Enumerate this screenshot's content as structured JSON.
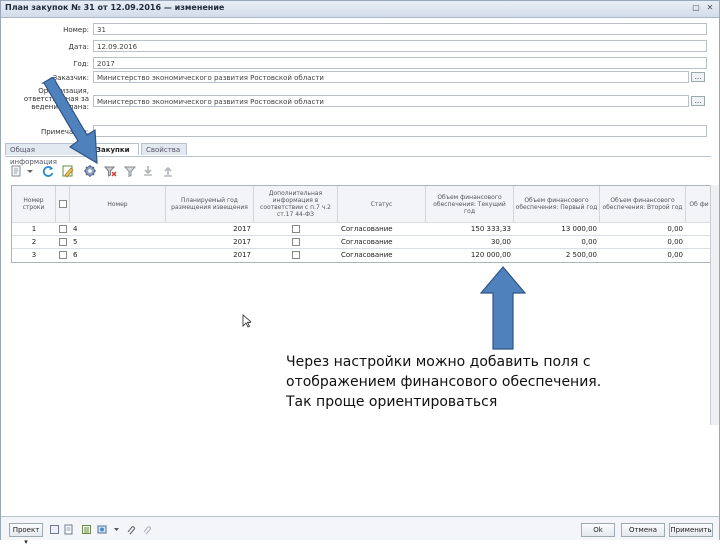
{
  "window": {
    "title": "План закупок № 31 от 12.09.2016 — изменение",
    "controls": [
      "▢",
      "✕"
    ]
  },
  "form": {
    "fields": [
      {
        "label": "Номер:",
        "value": "31"
      },
      {
        "label": "Дата:",
        "value": "12.09.2016"
      },
      {
        "label": "Год:",
        "value": "2017"
      },
      {
        "label": "Заказчик:",
        "value": "Министерство экономического развития Ростовской области"
      },
      {
        "label": "Организация, ответственная за ведение плана:",
        "value": "Министерство экономического развития Ростовской области"
      },
      {
        "label": "Примечание:",
        "value": ""
      }
    ]
  },
  "tabs": [
    "Общая информация",
    "Закупки",
    "Свойства"
  ],
  "toolbar": {
    "icons": [
      "new-doc-icon",
      "dropdown-icon",
      "refresh-icon",
      "edit-icon",
      "settings-icon",
      "clear-filter-icon",
      "filter-icon",
      "download-icon",
      "upload-icon"
    ]
  },
  "grid": {
    "columns": [
      "Номер строки",
      "",
      "Номер",
      "Планируемый год размещения извещения",
      "Дополнительная информация в соответствии с п.7 ч.2 ст.17 44-ФЗ",
      "Статус",
      "Объем финансового обеспечения: Текущий год",
      "Объем финансового обеспечения: Первый год",
      "Объем финансового обеспечения: Второй год",
      "Об фи"
    ],
    "rows": [
      {
        "num": "1",
        "code": "4",
        "year": "2017",
        "status": "Согласование",
        "current": "150 333,33",
        "first": "13 000,00",
        "second": "0,00"
      },
      {
        "num": "2",
        "code": "5",
        "year": "2017",
        "status": "Согласование",
        "current": "30,00",
        "first": "0,00",
        "second": "0,00"
      },
      {
        "num": "3",
        "code": "6",
        "year": "2017",
        "status": "Согласование",
        "current": "120 000,00",
        "first": "2 500,00",
        "second": "0,00"
      }
    ]
  },
  "annotation": {
    "lines": [
      "Через настройки можно добавить поля с",
      "отображением финансового обеспечения.",
      "Так проще ориентироваться"
    ]
  },
  "bottom": {
    "project_label": "Проект ▾",
    "ok_label": "Ok",
    "cancel_label": "Отмена",
    "apply_label": "Применить"
  },
  "colors": {
    "arrow_fill": "#4f81bd",
    "arrow_stroke": "#2f5486"
  }
}
